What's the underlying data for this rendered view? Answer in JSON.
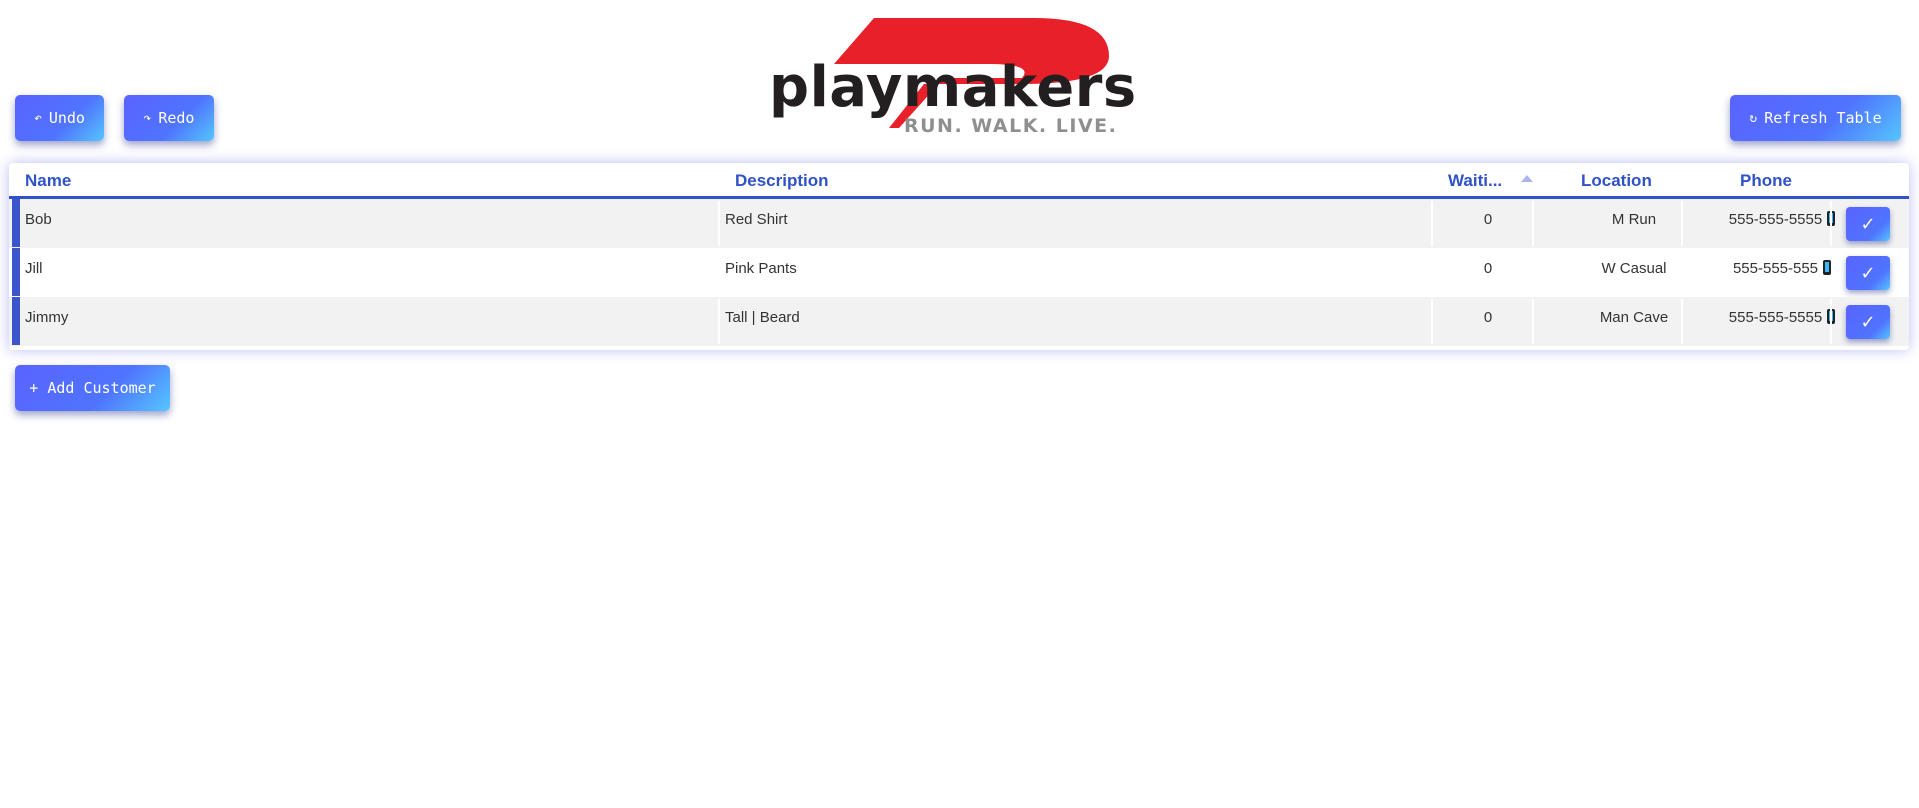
{
  "toolbar": {
    "undo_label": "Undo",
    "redo_label": "Redo",
    "refresh_label": "Refresh Table",
    "add_label": "+ Add Customer"
  },
  "logo": {
    "brand": "playmakers",
    "tagline": "RUN. WALK. LIVE.",
    "colors": {
      "red": "#e8202a",
      "dark": "#231f20",
      "gray": "#8f8f8f"
    }
  },
  "table": {
    "headers": {
      "name": "Name",
      "description": "Description",
      "waiting": "Waiti...",
      "location": "Location",
      "phone": "Phone"
    },
    "rows": [
      {
        "name": "Bob",
        "description": "Red Shirt",
        "waiting": "0",
        "location": "M Run",
        "phone": "555-555-5555",
        "action": "✓"
      },
      {
        "name": "Jill",
        "description": "Pink Pants",
        "waiting": "0",
        "location": "W Casual",
        "phone": "555-555-555",
        "action": "✓"
      },
      {
        "name": "Jimmy",
        "description": "Tall | Beard",
        "waiting": "0",
        "location": "Man Cave",
        "phone": "555-555-5555",
        "action": "✓"
      }
    ]
  },
  "colors": {
    "accent": "#2f52c8",
    "button_gradient_start": "#5a63ff",
    "button_gradient_end": "#55c6ff"
  },
  "icons": {
    "undo": "undo-icon",
    "redo": "redo-icon",
    "refresh": "refresh-icon",
    "phone": "phone-icon",
    "check": "check-icon",
    "sort": "sort-ascending-icon"
  }
}
